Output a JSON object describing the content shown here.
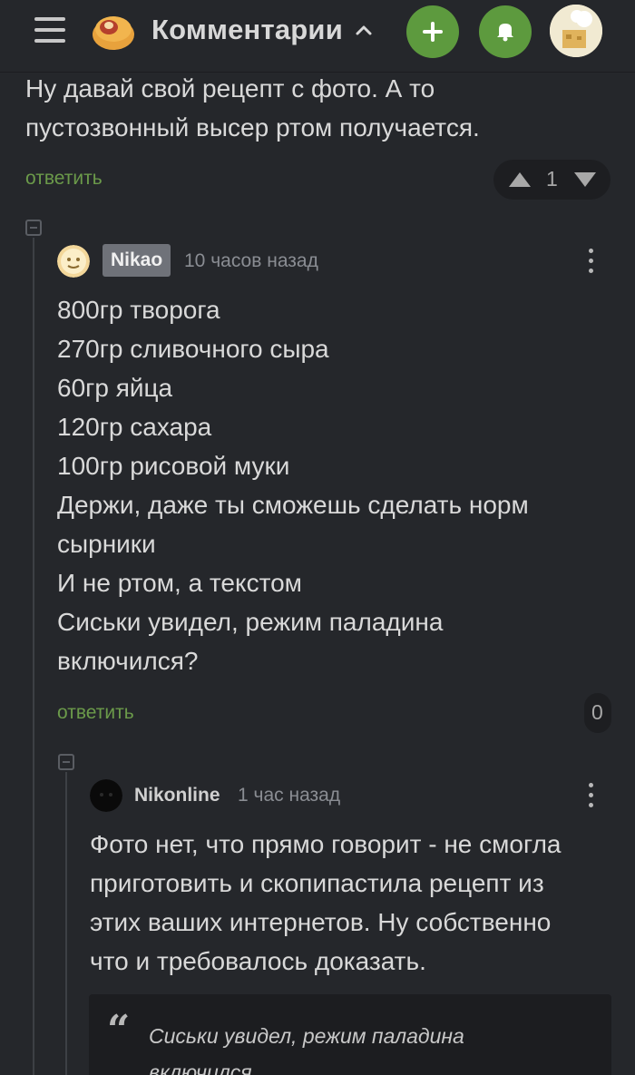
{
  "header": {
    "title": "Комментарии",
    "menu_icon": "hamburger-menu-icon",
    "logo_icon": "site-logo-icon",
    "caret_icon": "chevron-up-icon",
    "add_icon": "plus-icon",
    "notify_icon": "bell-icon",
    "accent_color": "#5d9a3e"
  },
  "parent_comment": {
    "lines": [
      "Ну давай свой рецепт с фото. А то",
      "пустозвонный высер ртом получается."
    ],
    "reply_label": "ответить",
    "rating": "1"
  },
  "comment1": {
    "author": "Nikao",
    "time": "10 часов назад",
    "lines": [
      "800гр творога",
      "270гр сливочного сыра",
      "60гр яйца",
      "120гр сахара",
      "100гр рисовой муки",
      "Держи, даже ты сможешь сделать норм",
      "сырники",
      "И не ртом, а текстом",
      "Сиськи увидел, режим паладина",
      "включился?"
    ],
    "reply_label": "ответить",
    "rating": "0"
  },
  "comment2": {
    "author": "Nikonline",
    "time": "1 час назад",
    "lines": [
      "Фото нет, что прямо говорит - не смогла",
      "приготовить и скопипастила рецепт из",
      "этих ваших интернетов. Ну собственно",
      "что и требовалось доказать."
    ],
    "quote_mark": "“",
    "quote_lines": [
      "Сиськи увидел, режим паладина",
      "включился"
    ]
  }
}
